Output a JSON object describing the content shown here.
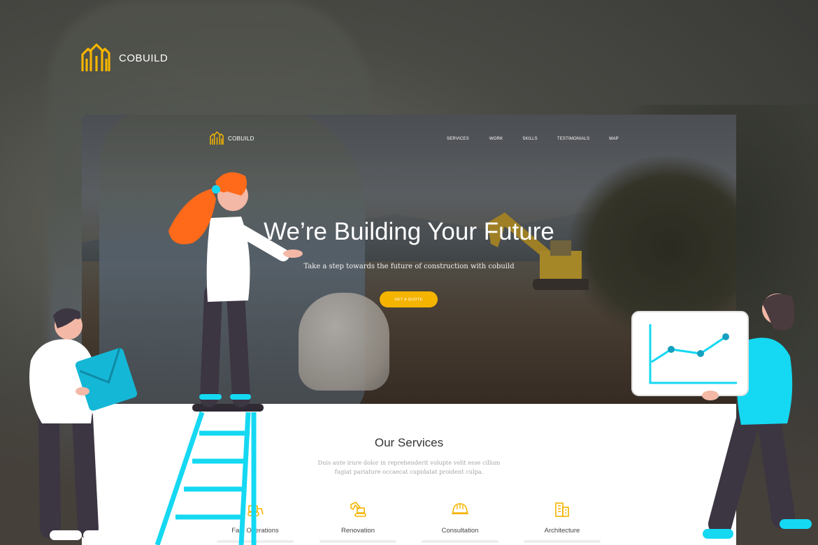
{
  "brand": {
    "name": "COBUILD",
    "accent": "#f5b400",
    "logo_icon": "building-logo-icon"
  },
  "nav": {
    "brand": "COBUILD",
    "items": [
      "SERVICES",
      "WORK",
      "SKILLS",
      "TESTIMONIALS",
      "MAP"
    ]
  },
  "hero": {
    "title": "We’re Building Your Future",
    "subtitle": "Take a step towards the future of construction with cobuild",
    "cta_label": "GET A QUOTE"
  },
  "services": {
    "title": "Our Services",
    "description": "Duis aute irure dolor in reprehenderit volupte velit esse cillum fugiat pariature occaecat cupidatat proident culpa.",
    "items": [
      {
        "label": "Fast Operations",
        "icon": "bulldozer-icon"
      },
      {
        "label": "Renovation",
        "icon": "excavator-icon"
      },
      {
        "label": "Consultation",
        "icon": "helmet-icon"
      },
      {
        "label": "Architecture",
        "icon": "buildings-icon"
      }
    ]
  },
  "colors": {
    "illustration_cyan": "#15d8f2",
    "illustration_orange": "#ff6a1a",
    "illustration_dark": "#3c3542"
  }
}
